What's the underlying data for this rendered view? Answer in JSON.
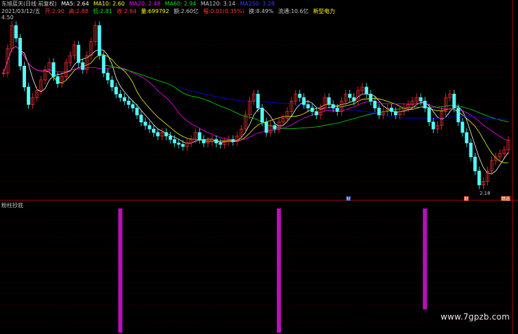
{
  "header": {
    "title": "东旭蓝天(日线 前复权)",
    "ma5": "MA5: 2.64",
    "ma10": "MA10: 2.60",
    "ma20": "MA20: 2.48",
    "ma60": "MA60: 2.94",
    "ma120": "MA120: 3.14",
    "ma250": "MA250: 3.28",
    "date": "2021/03/12/五",
    "open": "开:2.90",
    "high": "高:2.88",
    "low": "低:2.81",
    "close": "收:2.84",
    "volume": "量:699792",
    "amount": "额:2.60亿",
    "change": "幅:0.01(0.35%)",
    "turnover": "换:8.49%",
    "float": "流通:10.6亿",
    "sector": "新型电力"
  },
  "colors": {
    "up": "#ff3232",
    "down": "#54ffff",
    "ma5": "#ffffff",
    "ma10": "#ffff00",
    "ma20": "#ff00ff",
    "ma60": "#00e600",
    "ma120": "#0000ff",
    "bar": "#ba0fba",
    "grid": "#8b0000"
  },
  "axis": {
    "top_label": "4.50",
    "low_label": "2.18"
  },
  "indicator": {
    "title": "粉柱抄底"
  },
  "badges": [
    "财",
    "财",
    "精选"
  ],
  "watermark": "www.7gpzb.com",
  "chart_data": {
    "type": "candlestick",
    "series_price": [
      3.8,
      4.15,
      4.48,
      4.3,
      3.9,
      3.6,
      3.35,
      3.45,
      3.55,
      3.7,
      3.85,
      3.95,
      3.75,
      3.65,
      3.75,
      3.95,
      4.05,
      4.2,
      3.95,
      3.85,
      4.05,
      4.25,
      4.48,
      4.05,
      3.8,
      3.7,
      3.6,
      3.5,
      3.45,
      3.4,
      3.35,
      3.3,
      3.2,
      3.1,
      3.05,
      3.0,
      2.95,
      2.9,
      2.95,
      2.9,
      2.85,
      2.8,
      2.78,
      2.75,
      2.8,
      2.85,
      2.95,
      2.85,
      2.8,
      2.82,
      2.85,
      2.8,
      2.78,
      2.82,
      2.85,
      2.82,
      2.9,
      3.0,
      3.2,
      3.4,
      3.5,
      3.3,
      3.1,
      2.95,
      3.05,
      3.0,
      3.1,
      3.15,
      3.25,
      3.4,
      3.5,
      3.45,
      3.35,
      3.3,
      3.25,
      3.2,
      3.3,
      3.45,
      3.35,
      3.3,
      3.25,
      3.4,
      3.5,
      3.45,
      3.4,
      3.55,
      3.6,
      3.5,
      3.4,
      3.3,
      3.2,
      3.25,
      3.3,
      3.25,
      3.2,
      3.25,
      3.3,
      3.35,
      3.4,
      3.45,
      3.4,
      3.3,
      3.1,
      3.0,
      3.05,
      3.25,
      3.45,
      3.5,
      3.3,
      3.1,
      2.95,
      2.8,
      2.6,
      2.4,
      2.2,
      2.25,
      2.4,
      2.55,
      2.6,
      2.65,
      2.7,
      2.84
    ],
    "pink_bars": [
      {
        "index": 28,
        "height": 1.0
      },
      {
        "index": 66,
        "height": 1.0
      },
      {
        "index": 101,
        "height": 0.82
      }
    ],
    "ylim": [
      2.0,
      4.6
    ]
  }
}
